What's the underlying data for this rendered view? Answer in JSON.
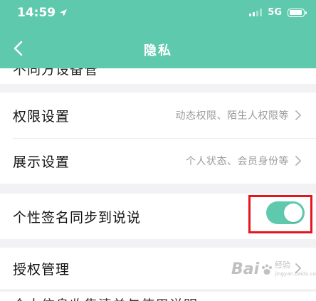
{
  "status_bar": {
    "time": "14:59",
    "network": "5G"
  },
  "header": {
    "title": "隐私"
  },
  "partial_top_text": "不同方设备管",
  "group_permissions": {
    "items": [
      {
        "label": "权限设置",
        "value": "动态权限、陌生人权限等"
      },
      {
        "label": "展示设置",
        "value": "个人状态、会员身份等"
      }
    ]
  },
  "group_signature": {
    "label": "个性签名同步到说说",
    "toggle_on": true
  },
  "group_auth": {
    "label": "授权管理"
  },
  "partial_bottom_text": "个人信息收集清单与使用说明",
  "watermark": {
    "brand": "Bai",
    "tail": "经验",
    "sub": "jingyan.baidu.com"
  },
  "colors": {
    "accent": "#5fc9ae",
    "highlight": "#e8141c"
  }
}
